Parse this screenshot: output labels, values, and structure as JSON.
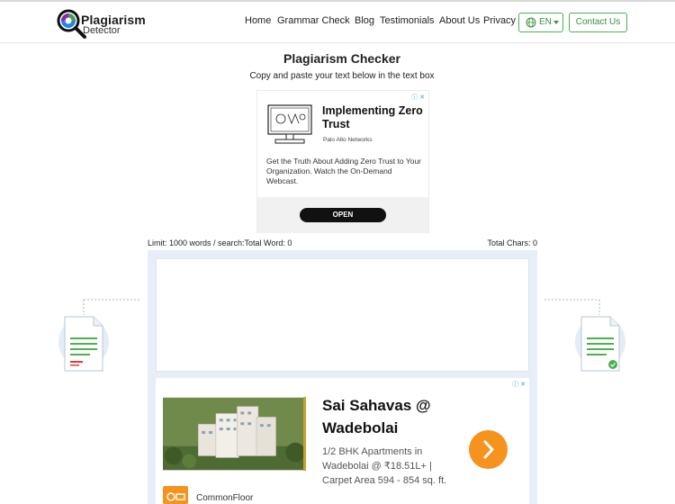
{
  "header": {
    "logo_title": "Plagiarism",
    "logo_sub": "Detector",
    "nav": [
      "Home",
      "Grammar Check",
      "Blog",
      "Testimonials",
      "About Us",
      "Privacy"
    ],
    "lang_label": "EN",
    "contact_label": "Contact Us"
  },
  "main": {
    "title": "Plagiarism Checker",
    "subtitle": "Copy and paste your text below in the text box",
    "limit_text": "Limit: 1000 words / search:Total Word: 0",
    "chars_text": "Total Chars: 0"
  },
  "ad1": {
    "title": "Implementing Zero Trust",
    "brand": "Palo Alto Networks",
    "description": "Get the Truth About Adding Zero Trust to Your Organization. Watch the On-Demand Webcast.",
    "button": "OPEN"
  },
  "ad2": {
    "title": "Sai Sahavas @ Wadebolai",
    "description": "1/2 BHK Apartments in Wadebolai @ ₹18.51L+ | Carpet Area 594 - 854 sq. ft.",
    "brand": "CommonFloor"
  },
  "colors": {
    "accent_green": "#4caf50",
    "panel_bg": "#e7eef7",
    "ad_cta_orange": "#f6921e"
  },
  "icons": [
    "logo-magnifier-icon",
    "globe-icon",
    "caret-down-icon",
    "ad-choices-icon",
    "monitor-icon",
    "arrow-right-icon",
    "document-icon",
    "check-icon"
  ]
}
